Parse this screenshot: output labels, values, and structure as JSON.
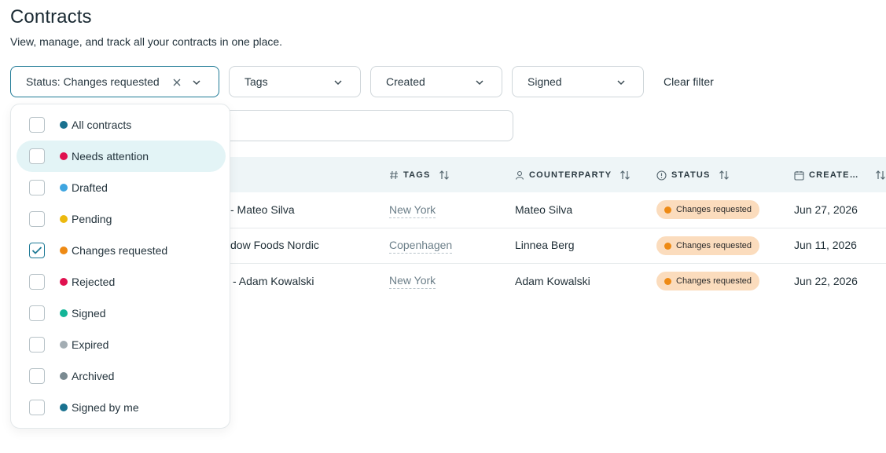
{
  "page": {
    "title": "Contracts",
    "subtitle": "View, manage, and track all your contracts in one place."
  },
  "filters": {
    "status_label": "Status: Changes requested",
    "tags_label": "Tags",
    "created_label": "Created",
    "signed_label": "Signed",
    "clear_label": "Clear filter"
  },
  "table": {
    "columns": {
      "tags": "TAGS",
      "counterparty": "COUNTERPARTY",
      "status": "STATUS",
      "created": "CREATE…"
    },
    "rows": [
      {
        "name": "- Mateo Silva",
        "tag": "New York",
        "counterparty": "Mateo Silva",
        "status": "Changes requested",
        "created": "Jun 27, 2026"
      },
      {
        "name": "dow Foods Nordic",
        "tag": "Copenhagen",
        "counterparty": "Linnea Berg",
        "status": "Changes requested",
        "created": "Jun 11, 2026"
      },
      {
        "name": "- Adam Kowalski",
        "tag": "New York",
        "counterparty": "Adam Kowalski",
        "status": "Changes requested",
        "created": "Jun 22, 2026"
      }
    ]
  },
  "status_options": [
    {
      "label": "All contracts",
      "color": "#19718f",
      "checked": false
    },
    {
      "label": "Needs attention",
      "color": "#e0114f",
      "checked": false
    },
    {
      "label": "Drafted",
      "color": "#3fa5e0",
      "checked": false
    },
    {
      "label": "Pending",
      "color": "#ecb90f",
      "checked": false
    },
    {
      "label": "Changes requested",
      "color": "#ee8a14",
      "checked": true
    },
    {
      "label": "Rejected",
      "color": "#e0114f",
      "checked": false
    },
    {
      "label": "Signed",
      "color": "#13b597",
      "checked": false
    },
    {
      "label": "Expired",
      "color": "#a3adb3",
      "checked": false
    },
    {
      "label": "Archived",
      "color": "#7a8a91",
      "checked": false
    },
    {
      "label": "Signed by me",
      "color": "#19718f",
      "checked": false
    }
  ],
  "colors": {
    "accent": "#1f7a96",
    "badge_bg": "#fbdcbd",
    "badge_dot": "#ee8a14"
  }
}
